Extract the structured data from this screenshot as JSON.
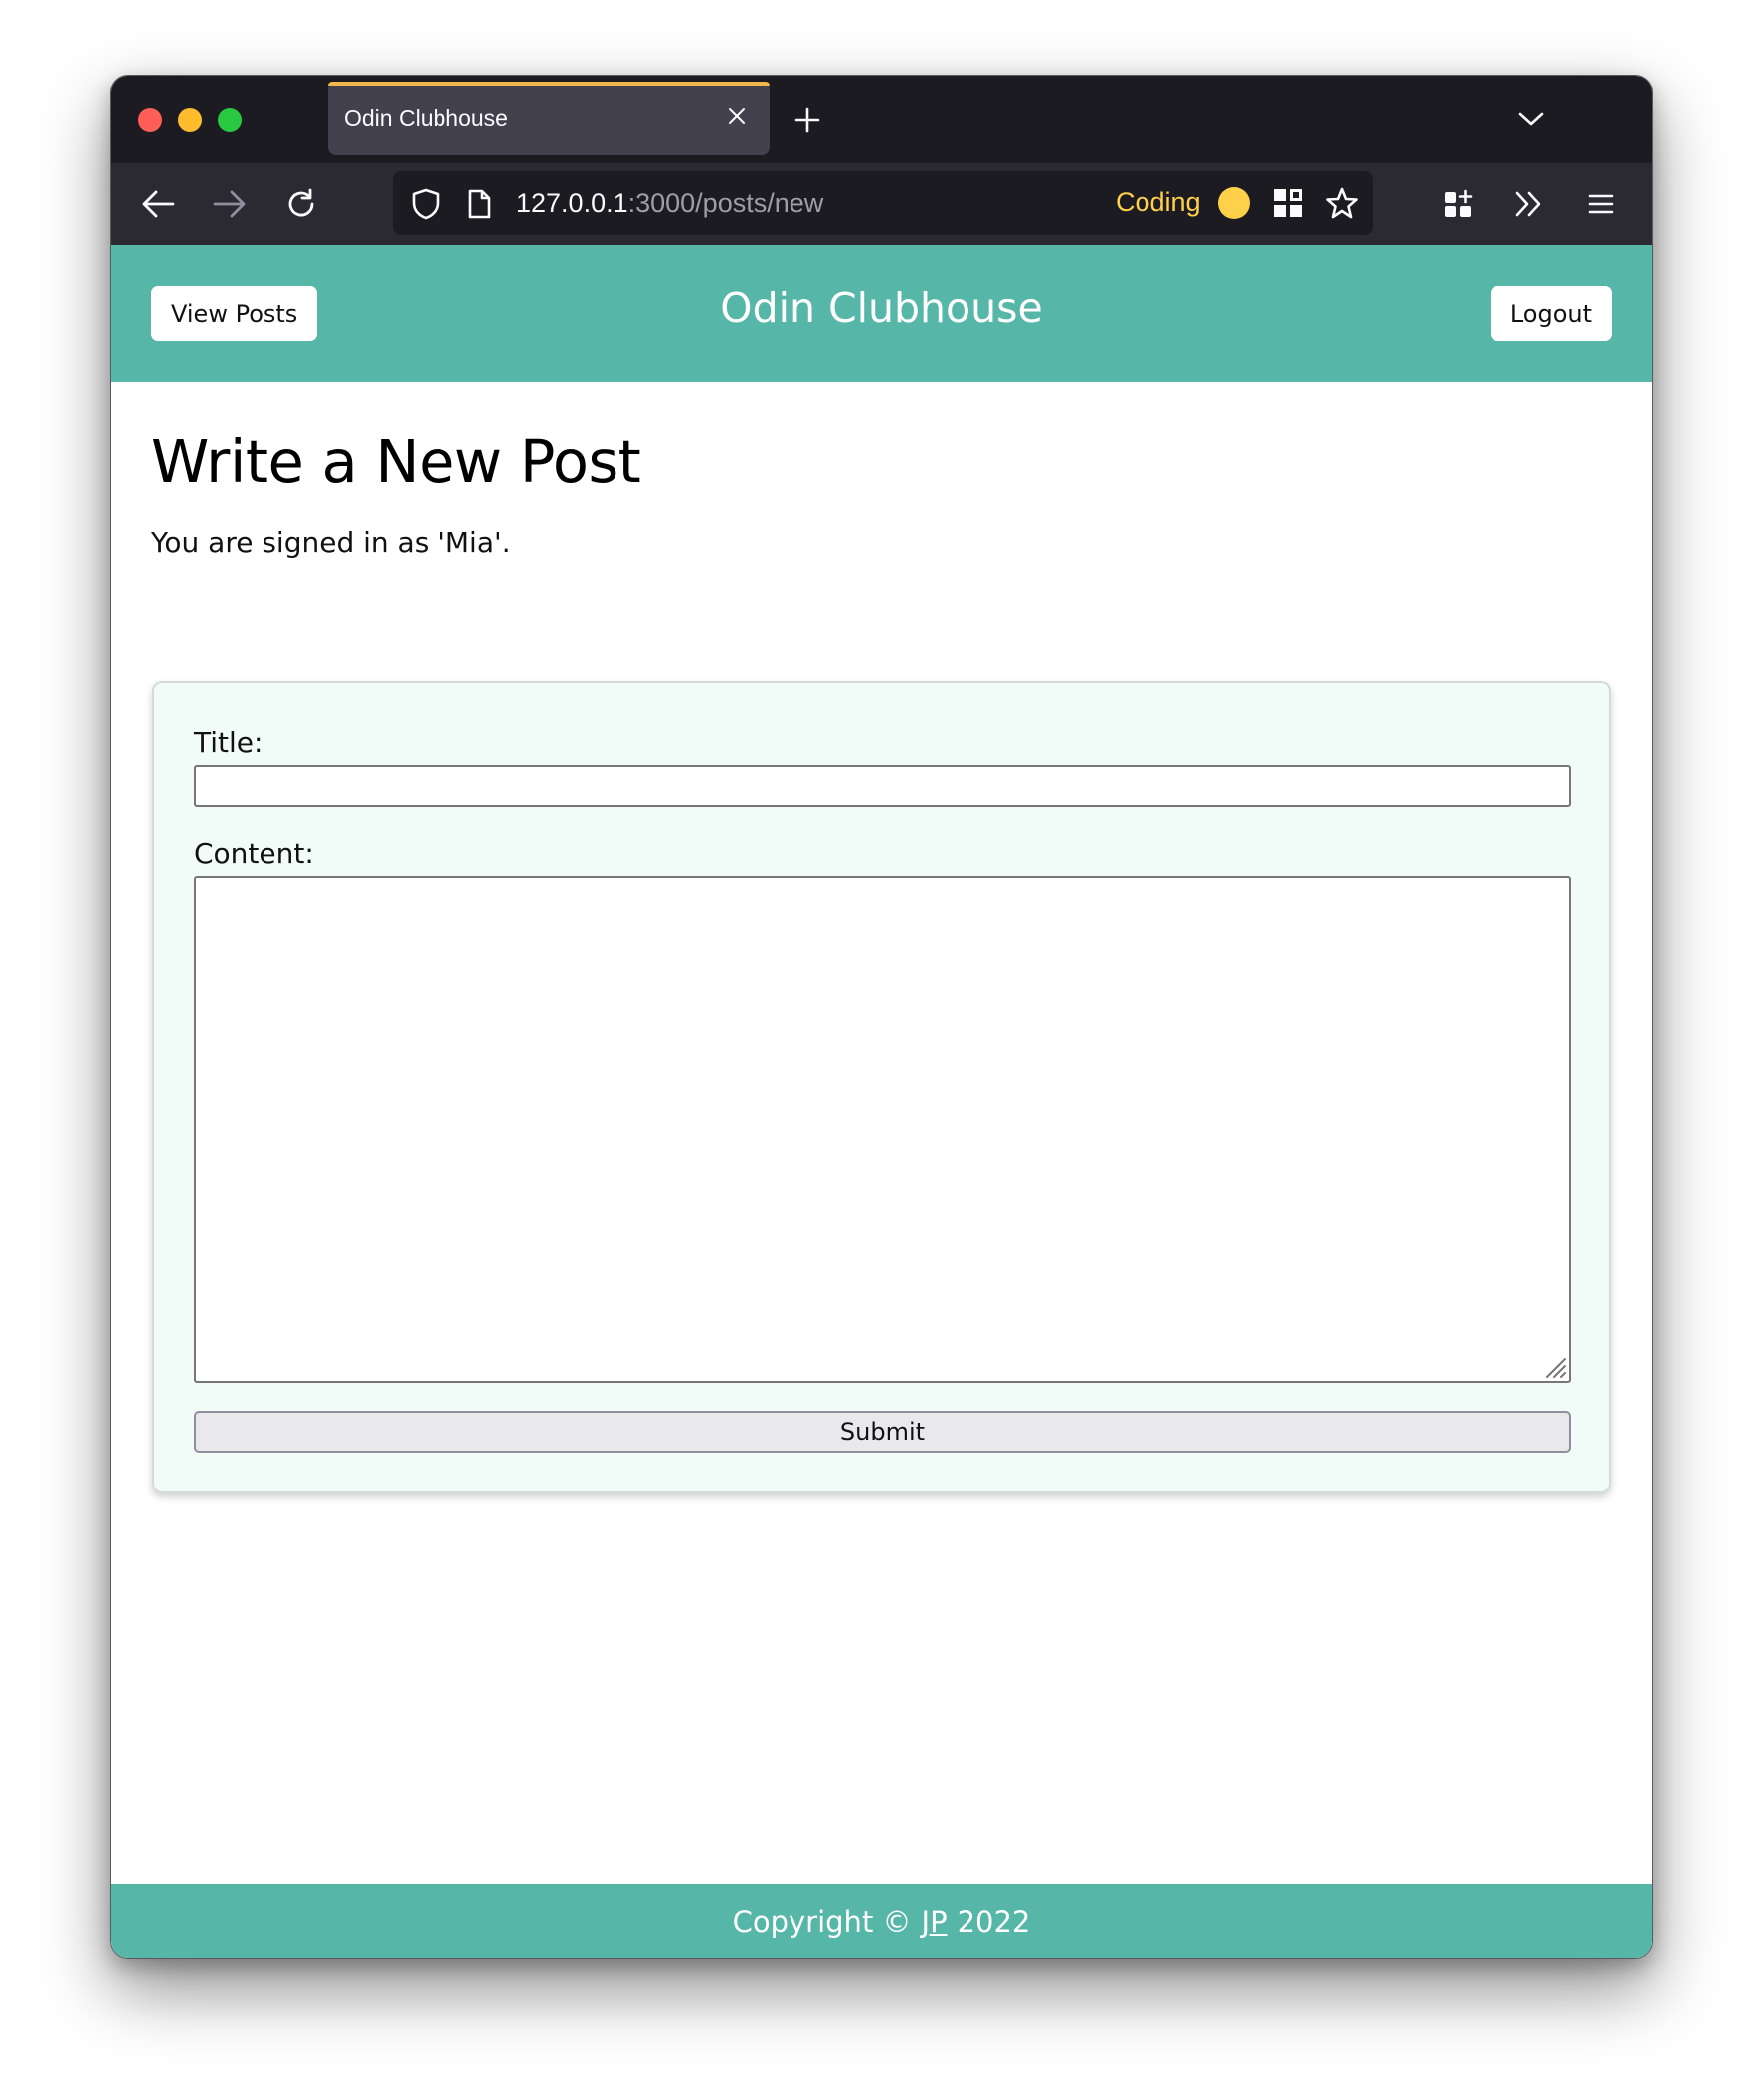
{
  "browser": {
    "tab": {
      "title": "Odin Clubhouse"
    },
    "url": {
      "host": "127.0.0.1",
      "rest": ":3000/posts/new"
    },
    "extension_label": "Coding",
    "accent_color": "#f2b84b",
    "icons": [
      "close-icon",
      "plus-icon",
      "chevron-down-icon",
      "back-arrow-icon",
      "forward-arrow-icon",
      "reload-icon",
      "shield-icon",
      "page-icon",
      "qr-code-icon",
      "star-icon",
      "extensions-icon",
      "overflow-chevrons-icon",
      "hamburger-menu-icon"
    ]
  },
  "header": {
    "view_posts_label": "View Posts",
    "site_title": "Odin Clubhouse",
    "logout_label": "Logout",
    "color": "#56b6a7"
  },
  "main": {
    "heading": "Write a New Post",
    "signed_in_text": "You are signed in as 'Mia'.",
    "form": {
      "title_label": "Title:",
      "title_value": "",
      "content_label": "Content:",
      "content_value": "",
      "submit_label": "Submit"
    }
  },
  "footer": {
    "copyright_prefix": "Copyright ©",
    "author_link": "JP",
    "year": "2022"
  }
}
